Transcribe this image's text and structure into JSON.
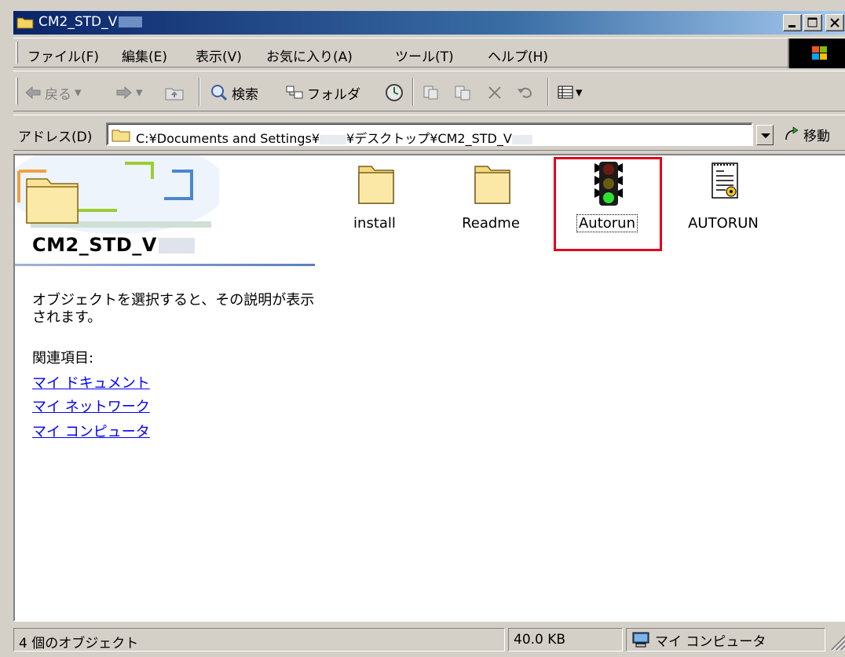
{
  "window": {
    "title": "CM2_STD_V",
    "colors": {
      "titlebar": "#0a246a",
      "face": "#d4d0c8",
      "link": "#0000ff",
      "highlight": "#e0001b"
    }
  },
  "menu": {
    "items": [
      "ファイル(F)",
      "編集(E)",
      "表示(V)",
      "お気に入り(A)",
      "ツール(T)",
      "ヘルプ(H)"
    ]
  },
  "toolbar": {
    "back_label": "戻る",
    "search_label": "検索",
    "folders_label": "フォルダ"
  },
  "address": {
    "label": "アドレス(D)",
    "path_prefix": "C:¥Documents and Settings¥",
    "path_suffix": "¥デスクトップ¥CM2_STD_V",
    "go_label": "移動"
  },
  "left_pane": {
    "title": "CM2_STD_V",
    "description": "オブジェクトを選択すると、その説明が表示されます。",
    "related_label": "関連項目:",
    "links": [
      "マイ ドキュメント",
      "マイ ネットワーク",
      "マイ コンピュータ"
    ]
  },
  "files": [
    {
      "name": "install",
      "icon": "folder-icon"
    },
    {
      "name": "Readme",
      "icon": "folder-icon"
    },
    {
      "name": "Autorun",
      "icon": "traffic-light-icon",
      "selected": true
    },
    {
      "name": "AUTORUN",
      "icon": "setup-info-file-icon"
    }
  ],
  "status": {
    "objects": "4 個のオブジェクト",
    "size": "40.0 KB",
    "zone": "マイ コンピュータ"
  }
}
